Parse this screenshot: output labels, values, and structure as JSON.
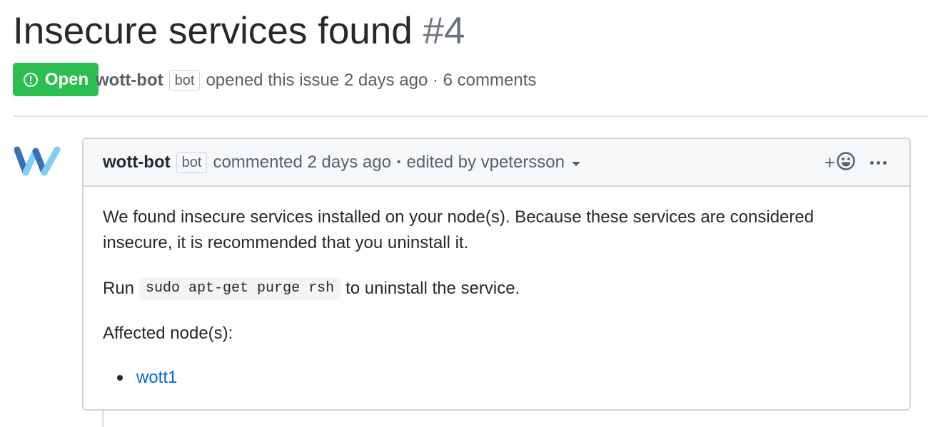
{
  "issue": {
    "title": "Insecure services found",
    "number": "#4",
    "state": "Open",
    "author": "wott-bot",
    "author_badge": "bot",
    "meta_text": "opened this issue 2 days ago · 6 comments"
  },
  "comment": {
    "author": "wott-bot",
    "author_badge": "bot",
    "commented_text": "commented 2 days ago",
    "separator": "•",
    "edited_text": "edited by vpetersson",
    "reaction_plus": "+",
    "body": {
      "paragraph_1": "We found insecure services installed on your node(s). Because these services are considered insecure, it is recommended that you uninstall it.",
      "run_prefix": "Run",
      "command": "sudo apt-get purge rsh",
      "run_suffix": "to uninstall the service.",
      "affected_label": "Affected node(s):",
      "nodes": [
        "wott1"
      ]
    }
  },
  "colors": {
    "open_green": "#2cbe4e",
    "link_blue": "#0366d6",
    "muted_text": "#586069",
    "border": "#d1d5da",
    "header_bg": "#f6f8fa",
    "avatar_dark_blue": "#3b6fb6",
    "avatar_light_blue": "#7fd0ef"
  },
  "icons": {
    "state_icon": "issue-opened-icon",
    "reaction_icon": "smiley-icon",
    "more_icon": "kebab-horizontal-icon",
    "caret_icon": "triangle-down-icon"
  }
}
